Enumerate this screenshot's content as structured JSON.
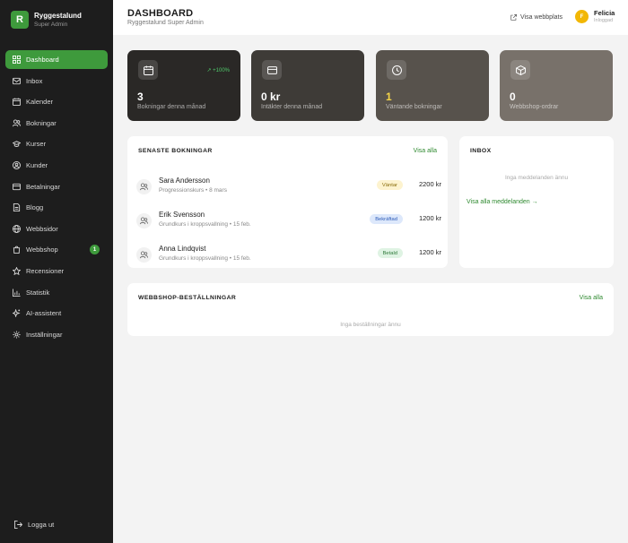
{
  "brand": {
    "logo": "R",
    "name": "Ryggestalund",
    "role": "Super Admin"
  },
  "nav": [
    {
      "label": "Dashboard",
      "icon": "grid-icon",
      "active": true
    },
    {
      "label": "Inbox",
      "icon": "mail-icon"
    },
    {
      "label": "Kalender",
      "icon": "calendar-icon"
    },
    {
      "label": "Bokningar",
      "icon": "users-icon"
    },
    {
      "label": "Kurser",
      "icon": "graduation-cap-icon"
    },
    {
      "label": "Kunder",
      "icon": "user-circle-icon"
    },
    {
      "label": "Betalningar",
      "icon": "credit-card-icon"
    },
    {
      "label": "Blogg",
      "icon": "document-icon"
    },
    {
      "label": "Webbsidor",
      "icon": "globe-icon"
    },
    {
      "label": "Webbshop",
      "icon": "shopping-bag-icon",
      "badge": "1"
    },
    {
      "label": "Recensioner",
      "icon": "star-icon"
    },
    {
      "label": "Statistik",
      "icon": "bar-chart-icon"
    },
    {
      "label": "AI-assistent",
      "icon": "sparkle-icon"
    },
    {
      "label": "Inställningar",
      "icon": "gear-icon"
    }
  ],
  "logout": "Logga ut",
  "header": {
    "title": "DASHBOARD",
    "subtitle": "Ryggestalund Super Admin",
    "visit_label": "Visa webbplats",
    "user_initial": "F",
    "user_name": "Felicia",
    "user_status": "Inloggad"
  },
  "stats": [
    {
      "value": "3",
      "label": "Bokningar denna månad",
      "delta": "↗ +100%",
      "icon": "calendar-icon",
      "bg": "#2a2826",
      "value_color": "#ffffff"
    },
    {
      "value": "0 kr",
      "label": "Intäkter denna månad",
      "icon": "credit-card-icon",
      "bg": "#3e3b37",
      "value_color": "#ffffff"
    },
    {
      "value": "1",
      "label": "Väntande bokningar",
      "icon": "clock-icon",
      "bg": "#57524c",
      "value_color": "#f5d547"
    },
    {
      "value": "0",
      "label": "Webbshop-ordrar",
      "icon": "box-icon",
      "bg": "#78716a",
      "value_color": "#ffffff"
    }
  ],
  "recent_bookings": {
    "title": "SENASTE BOKNINGAR",
    "link": "Visa alla",
    "items": [
      {
        "name": "Sara Andersson",
        "course": "Progressionskurs • 8 mars",
        "status": "Väntar",
        "status_bg": "#fdf3cf",
        "status_color": "#8a6d0b",
        "price": "2200 kr"
      },
      {
        "name": "Erik Svensson",
        "course": "Grundkurs i kroppsvallning • 15 feb.",
        "status": "Bekräftad",
        "status_bg": "#dde8fb",
        "status_color": "#2c5bb8",
        "price": "1200 kr"
      },
      {
        "name": "Anna Lindqvist",
        "course": "Grundkurs i kroppsvallning • 15 feb.",
        "status": "Betald",
        "status_bg": "#dff3e3",
        "status_color": "#2f7a3a",
        "price": "1200 kr"
      }
    ]
  },
  "inbox": {
    "title": "INBOX",
    "empty": "Inga meddelanden ännu",
    "link": "Visa alla meddelanden →"
  },
  "webshop_orders": {
    "title": "WEBBSHOP-BESTÄLLNINGAR",
    "link": "Visa alla",
    "empty": "Inga beställningar ännu"
  },
  "colors": {
    "accent": "#3e9a3c",
    "sidebar_bg": "#1d1d1d",
    "page_bg": "#f3f3f3"
  }
}
